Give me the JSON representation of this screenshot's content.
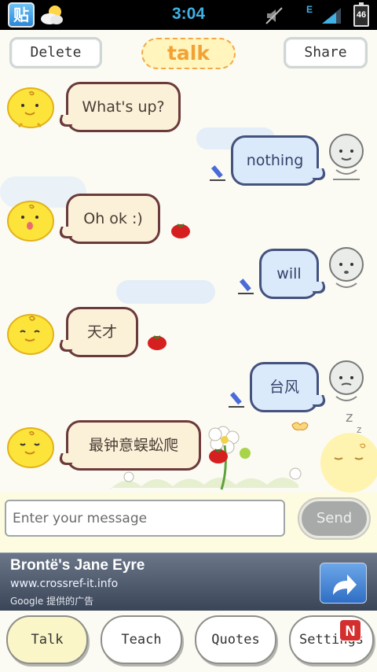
{
  "status_bar": {
    "time": "3:04",
    "network": "E",
    "battery": "46",
    "app_icon_glyph": "贴",
    "icons": [
      "app-icon",
      "weather-icon",
      "mute-icon",
      "signal-icon",
      "battery-icon"
    ]
  },
  "header": {
    "delete_label": "Delete",
    "title": "talk",
    "share_label": "Share"
  },
  "messages": [
    {
      "side": "left",
      "text": "What's up?"
    },
    {
      "side": "right",
      "text": "nothing"
    },
    {
      "side": "left",
      "text": "Oh ok :)"
    },
    {
      "side": "right",
      "text": "will"
    },
    {
      "side": "left",
      "text": "天才"
    },
    {
      "side": "right",
      "text": "台风"
    },
    {
      "side": "left",
      "text": "最钟意蜈蚣爬"
    }
  ],
  "composer": {
    "placeholder": "Enter your message",
    "send_label": "Send"
  },
  "ad": {
    "title": "Brontë's Jane Eyre",
    "url": "www.crossref-it.info",
    "provider": "Google 提供的广告"
  },
  "tabs": [
    {
      "label": "Talk",
      "active": true
    },
    {
      "label": "Teach",
      "active": false
    },
    {
      "label": "Quotes",
      "active": false
    },
    {
      "label": "Settings",
      "active": false
    }
  ],
  "notification_badge": "N",
  "colors": {
    "accent": "#3fb1e5",
    "title": "#f2a234",
    "left_bubble": "#fbf0d8",
    "right_bubble": "#dbeafa",
    "badge": "#d32f2f"
  }
}
